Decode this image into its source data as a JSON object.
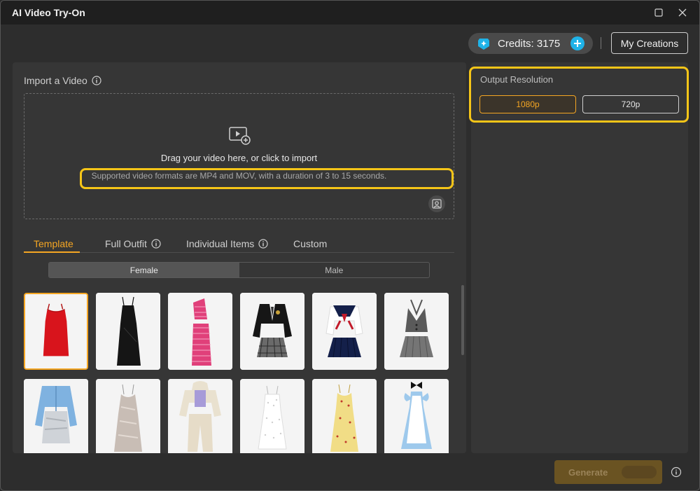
{
  "window": {
    "title": "AI Video Try-On",
    "maximize_icon": "maximize-icon",
    "close_icon": "close-icon"
  },
  "header": {
    "credits_label": "Credits: 3175",
    "credits_icon": "credits-gem-icon",
    "add_credits_icon": "plus-icon",
    "my_creations_label": "My Creations"
  },
  "import": {
    "label": "Import a Video",
    "drop_main": "Drag your video here, or click to import",
    "drop_sub": "Supported video formats are MP4 and MOV, with a duration of 3 to 15 seconds."
  },
  "tabs": [
    {
      "label": "Template",
      "active": true
    },
    {
      "label": "Full Outfit",
      "has_info": true
    },
    {
      "label": "Individual Items",
      "has_info": true
    },
    {
      "label": "Custom"
    }
  ],
  "gender": {
    "options": [
      "Female",
      "Male"
    ],
    "selected": "Female"
  },
  "templates": [
    {
      "name": "red-mini-dress",
      "selected": true
    },
    {
      "name": "black-slip-dress"
    },
    {
      "name": "pink-striped-set"
    },
    {
      "name": "black-blazer-plaid-skirt"
    },
    {
      "name": "sailor-uniform"
    },
    {
      "name": "grey-vest-skirt"
    },
    {
      "name": "blue-cardigan-silver-skirt"
    },
    {
      "name": "silver-slip-dress"
    },
    {
      "name": "cream-hoodie-set"
    },
    {
      "name": "white-eyelet-dress"
    },
    {
      "name": "yellow-floral-dress"
    },
    {
      "name": "alice-blue-dress"
    }
  ],
  "output": {
    "label": "Output Resolution",
    "options": [
      "1080p",
      "720p"
    ],
    "selected": "1080p"
  },
  "footer": {
    "generate_label": "Generate"
  },
  "colors": {
    "accent": "#f5a623",
    "highlight": "#f5c518",
    "credits_plus": "#1fb3e8"
  }
}
